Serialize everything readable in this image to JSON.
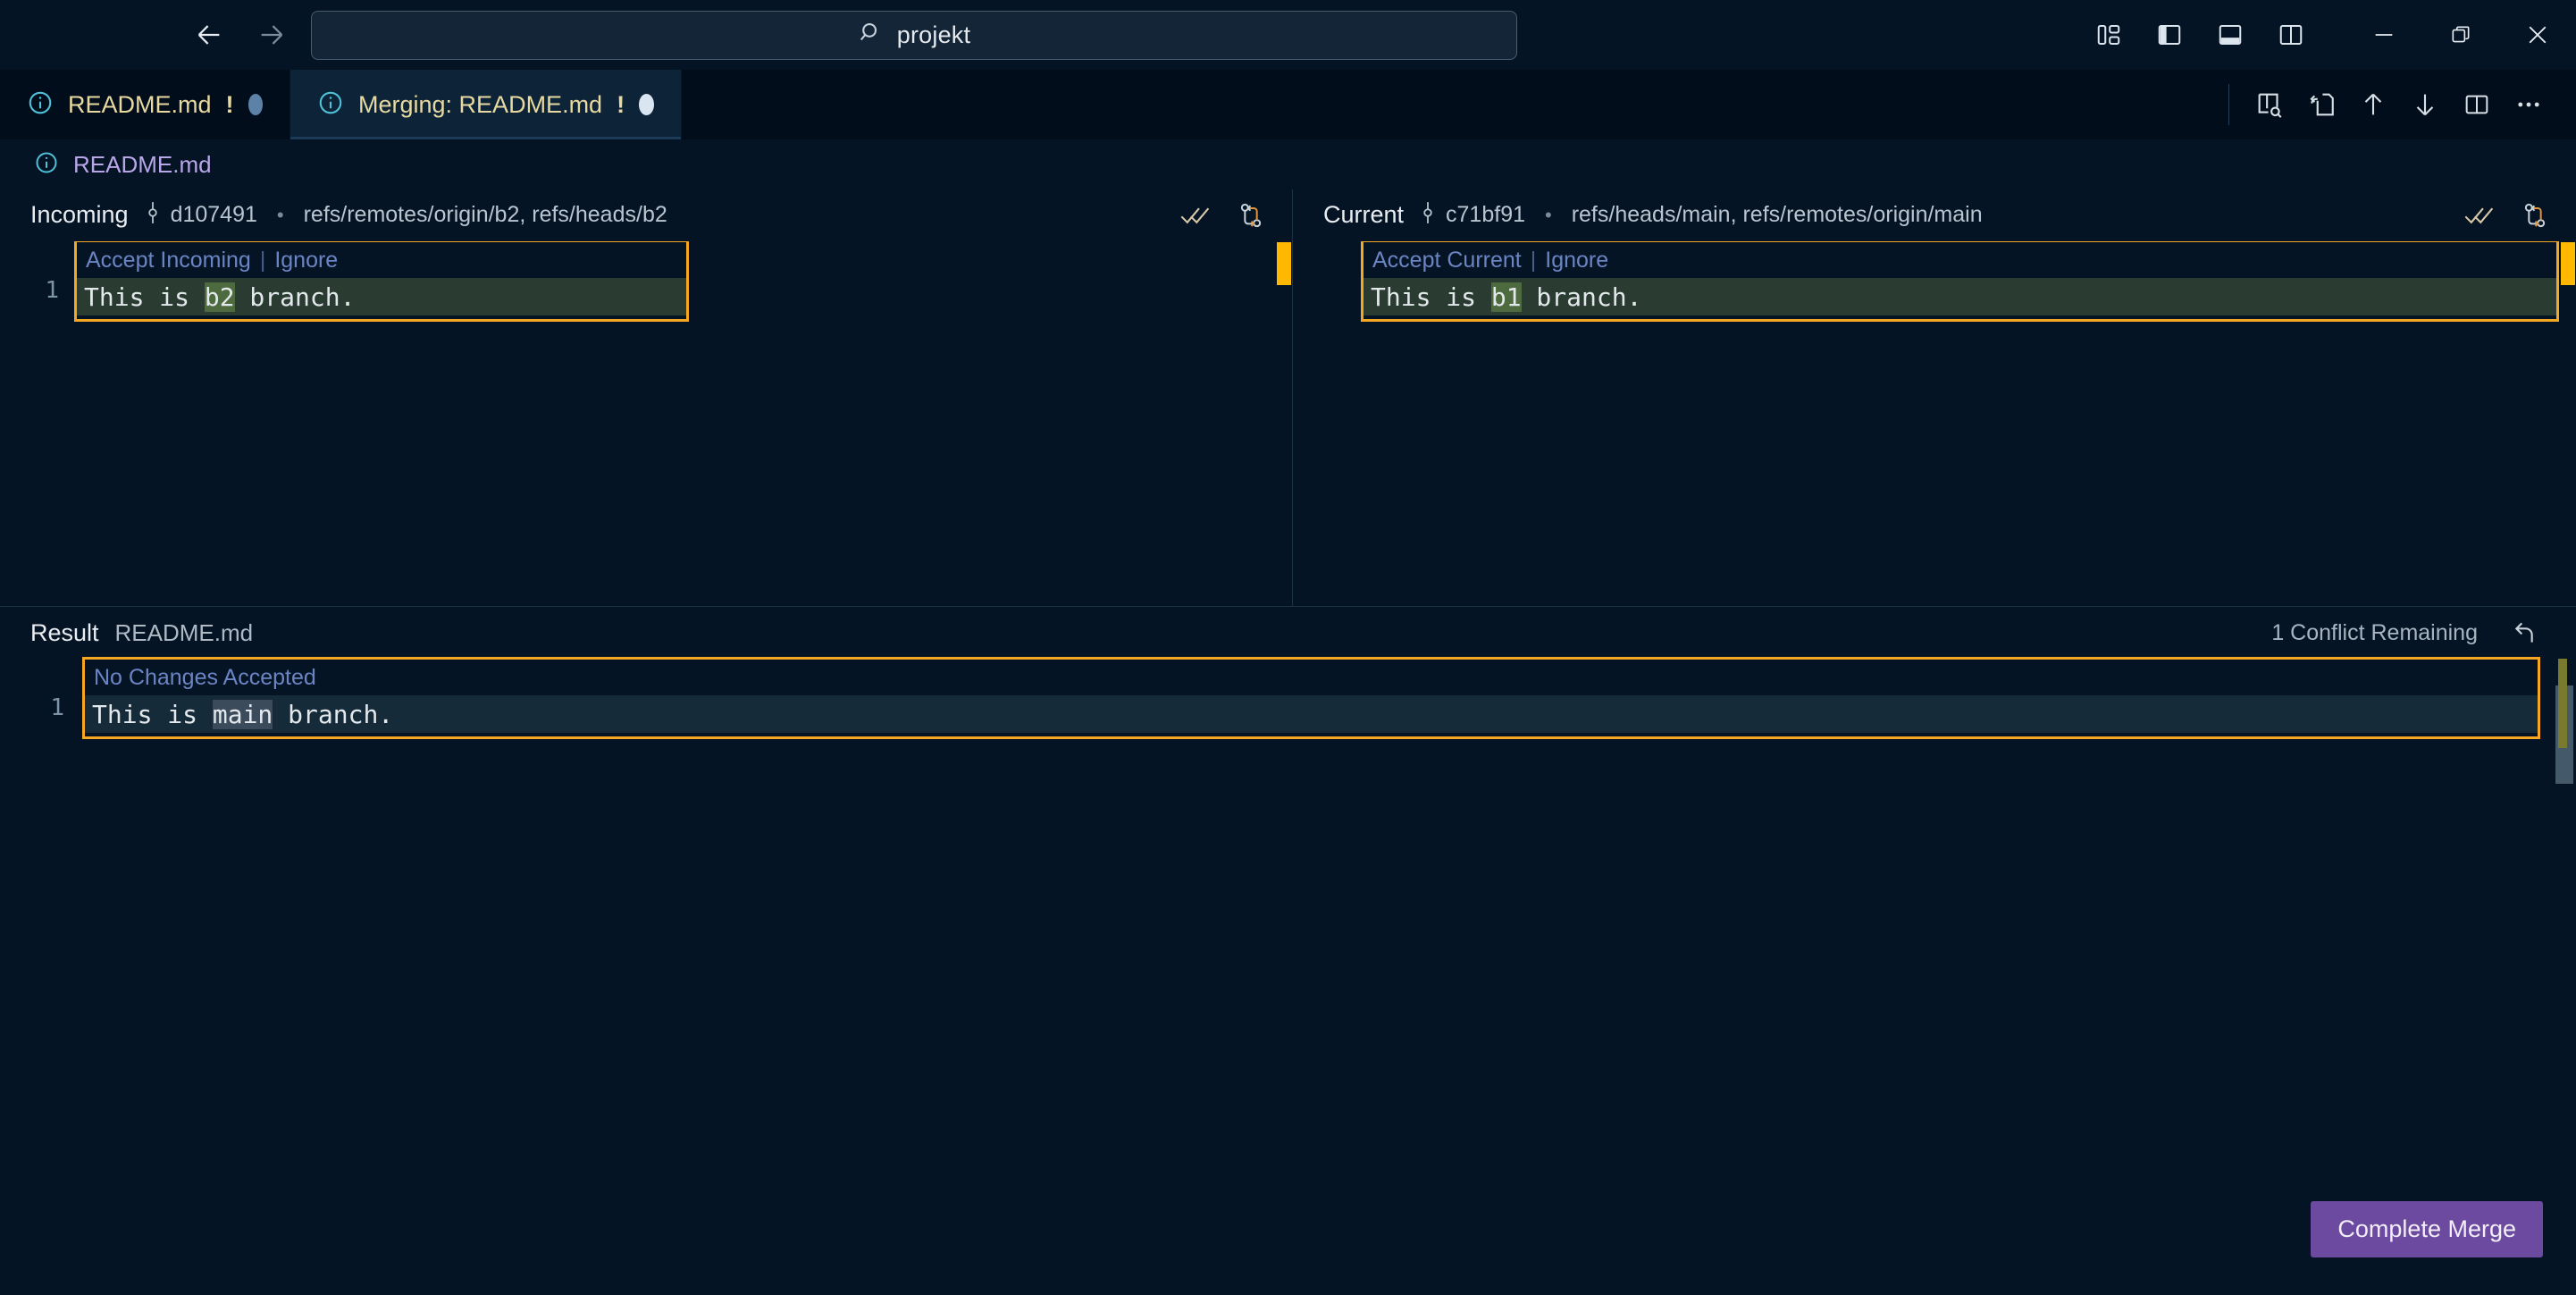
{
  "titlebar": {
    "back_icon": "arrow-left-icon",
    "forward_icon": "arrow-right-icon",
    "command_center": {
      "search_icon": "search-icon",
      "value": "projekt",
      "placeholder": "Search"
    },
    "layout_actions": [
      {
        "name": "customize-layout-icon",
        "label": "Customize Layout"
      },
      {
        "name": "toggle-primary-sidebar-icon",
        "label": "Toggle Primary Side Bar"
      },
      {
        "name": "toggle-panel-icon",
        "label": "Toggle Panel"
      },
      {
        "name": "toggle-secondary-sidebar-icon",
        "label": "Toggle Secondary Side Bar"
      }
    ],
    "window_controls": [
      {
        "name": "minimize-button",
        "label": "Minimize"
      },
      {
        "name": "restore-button",
        "label": "Restore"
      },
      {
        "name": "close-button",
        "label": "Close"
      }
    ]
  },
  "tabs": [
    {
      "icon": "info-icon",
      "label": "README.md",
      "warning": "!",
      "dirty": true,
      "active": false
    },
    {
      "icon": "info-icon",
      "label": "Merging: README.md",
      "warning": "!",
      "dirty": true,
      "active": true
    }
  ],
  "editor_actions": [
    {
      "name": "open-changes-icon",
      "label": "Open Changes"
    },
    {
      "name": "go-to-file-icon",
      "label": "Go To File"
    },
    {
      "name": "previous-conflict-icon",
      "label": "Previous Conflict"
    },
    {
      "name": "next-conflict-icon",
      "label": "Next Conflict"
    },
    {
      "name": "split-editor-icon",
      "label": "Split Editor"
    },
    {
      "name": "more-actions-icon",
      "label": "More Actions..."
    }
  ],
  "breadcrumb": {
    "icon": "info-icon",
    "label": "README.md"
  },
  "incoming": {
    "title": "Incoming",
    "commit_icon": "git-commit-icon",
    "hash": "d107491",
    "separator": "•",
    "refs": "refs/remotes/origin/b2, refs/heads/b2",
    "actions": [
      {
        "name": "accept-all-incoming-icon",
        "label": "Accept All Incoming"
      },
      {
        "name": "compare-with-base-icon",
        "label": "Compare With Base"
      }
    ],
    "lens": {
      "accept": "Accept Incoming",
      "pipe": "|",
      "ignore": "Ignore"
    },
    "line_number": "1",
    "code": {
      "prefix": "This is ",
      "highlight": "b2",
      "suffix": " branch."
    }
  },
  "current": {
    "title": "Current",
    "commit_icon": "git-commit-icon",
    "hash": "c71bf91",
    "separator": "•",
    "refs": "refs/heads/main, refs/remotes/origin/main",
    "actions": [
      {
        "name": "accept-all-current-icon",
        "label": "Accept All Current"
      },
      {
        "name": "compare-with-base-icon",
        "label": "Compare With Base"
      }
    ],
    "lens": {
      "accept": "Accept Current",
      "pipe": "|",
      "ignore": "Ignore"
    },
    "line_number": "1",
    "code": {
      "prefix": "This is ",
      "highlight": "b1",
      "suffix": " branch."
    }
  },
  "result": {
    "title": "Result",
    "file": "README.md",
    "conflict_count": "1 Conflict Remaining",
    "reset_icon": "reset-icon",
    "lens": "No Changes Accepted",
    "line_number": "1",
    "code": {
      "prefix": "This is ",
      "highlight": "main",
      "suffix": " branch."
    }
  },
  "footer": {
    "complete_merge_label": "Complete Merge"
  },
  "colors": {
    "background": "#041425",
    "tab_active": "#0d2338",
    "tab_label": "#e8d9a0",
    "breadcrumb_link": "#b8a6e8",
    "conflict_border": "#f5a623",
    "diff_line": "#2a3b31",
    "diff_word": "#4d6b3f",
    "result_line": "#152b3a",
    "result_word": "#3c4b5c",
    "lens_link": "#6b85c4",
    "button_primary": "#6c4aa0",
    "ruler_marker": "#ffb800"
  }
}
